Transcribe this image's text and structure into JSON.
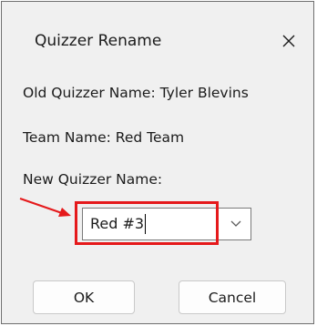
{
  "dialog": {
    "title": "Quizzer Rename",
    "old_name_line": "Old Quizzer Name: Tyler Blevins",
    "team_line": "Team Name: Red Team",
    "new_name_label": "New Quizzer Name:",
    "new_name_value": "Red #3",
    "ok_label": "OK",
    "cancel_label": "Cancel"
  },
  "annotation": {
    "highlight_color": "#e5191b",
    "arrow_color": "#e5191b"
  },
  "icons": {
    "close": "close-icon",
    "dropdown": "chevron-down-icon"
  }
}
